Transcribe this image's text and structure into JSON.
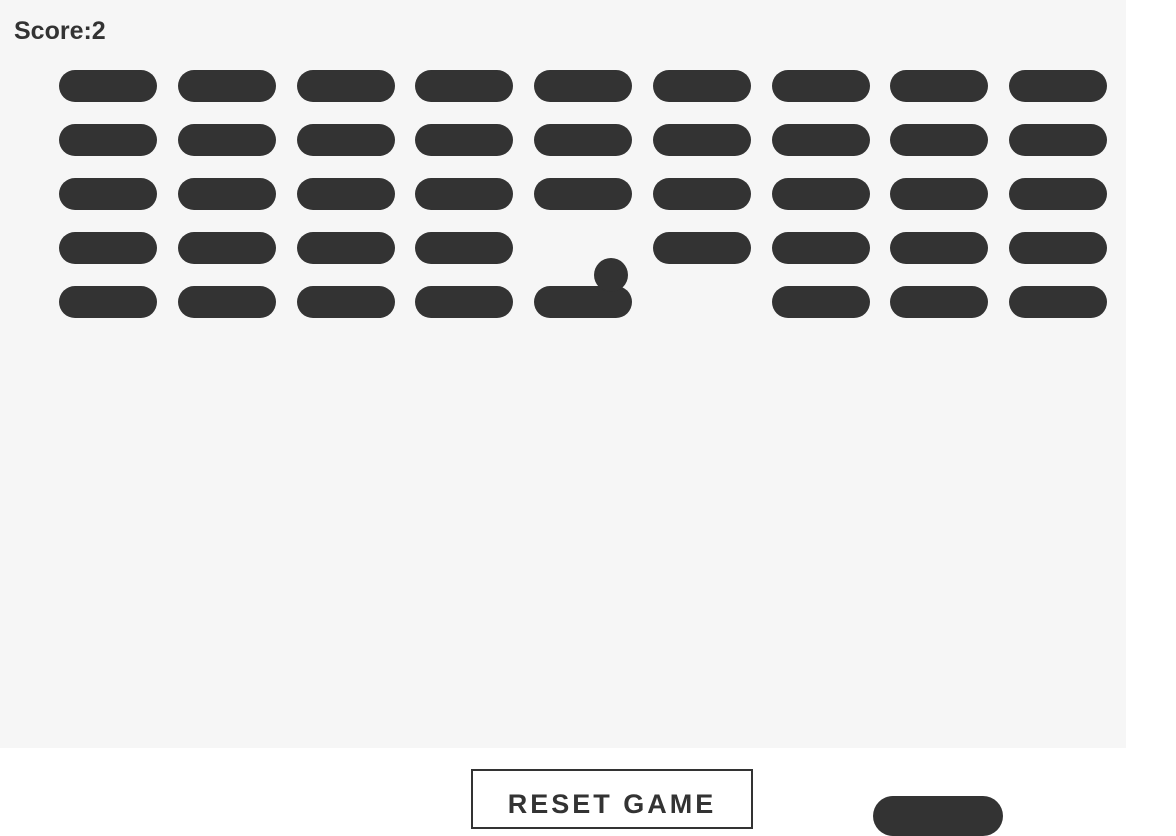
{
  "game": {
    "score_text": "Score:2",
    "reset_label": "RESET GAME",
    "bricks": {
      "rows": 5,
      "cols": 9,
      "missing": [
        [
          3,
          4
        ],
        [
          4,
          5
        ]
      ]
    },
    "colors": {
      "brick": "#333333",
      "ball": "#333333",
      "paddle": "#333333",
      "canvas_bg": "#f6f6f6"
    }
  }
}
